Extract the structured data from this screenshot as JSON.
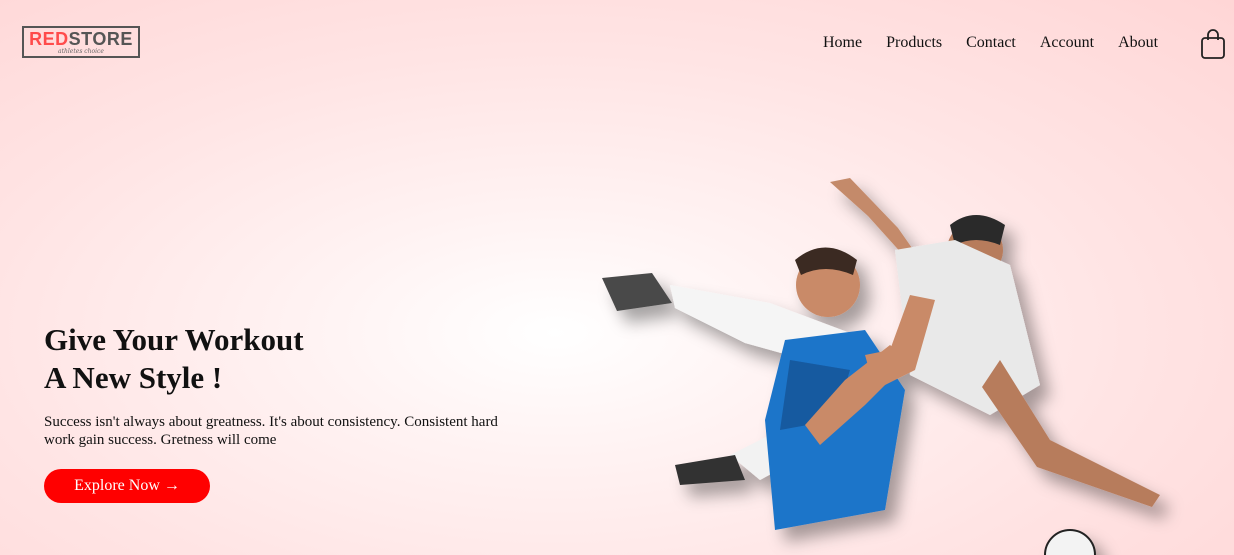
{
  "logo": {
    "brand_red": "RED",
    "brand_dark": "STORE",
    "tagline": "athletes choice"
  },
  "nav": {
    "items": [
      {
        "label": "Home"
      },
      {
        "label": "Products"
      },
      {
        "label": "Contact"
      },
      {
        "label": "Account"
      },
      {
        "label": "About"
      }
    ],
    "cart_icon": "shopping-bag-icon"
  },
  "hero": {
    "title_line1": "Give Your Workout",
    "title_line2": "A New Style !",
    "text": "Success isn't always about greatness. It's about consistency. Consistent hard work gain success. Gretness will come",
    "button_label": "Explore Now →",
    "image": "soccer-players-image"
  },
  "colors": {
    "accent": "#ff0000",
    "logo_red": "#ff4b4b",
    "background": "#ffe4e4"
  }
}
